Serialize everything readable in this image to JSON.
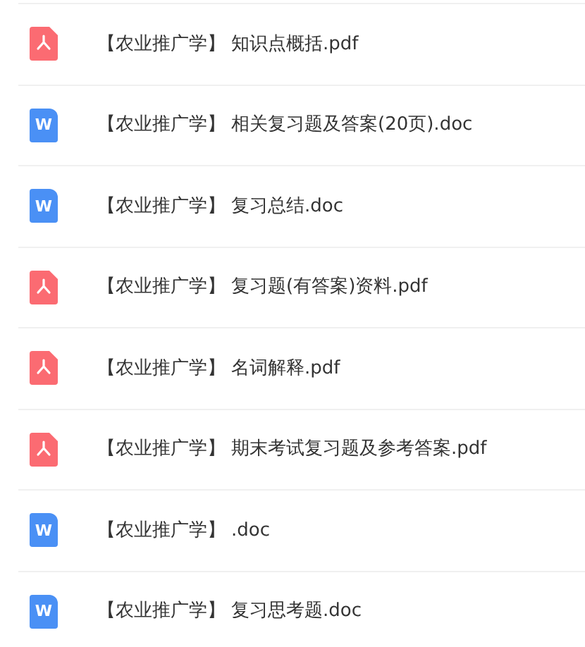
{
  "files": [
    {
      "kind": "pdf",
      "tag": "【农业推广学】",
      "name": "知识点概括.pdf"
    },
    {
      "kind": "doc",
      "badge": "W",
      "tag": "【农业推广学】",
      "name": "相关复习题及答案(20页).doc"
    },
    {
      "kind": "doc",
      "badge": "W",
      "tag": "【农业推广学】",
      "name": "复习总结.doc"
    },
    {
      "kind": "pdf",
      "tag": "【农业推广学】",
      "name": "复习题(有答案)资料.pdf"
    },
    {
      "kind": "pdf",
      "tag": "【农业推广学】",
      "name": "名词解释.pdf"
    },
    {
      "kind": "pdf",
      "tag": "【农业推广学】",
      "name": "期末考试复习题及参考答案.pdf"
    },
    {
      "kind": "doc",
      "badge": "W",
      "tag": "【农业推广学】",
      "name": ".doc"
    },
    {
      "kind": "doc",
      "badge": "W",
      "tag": "【农业推广学】",
      "name": "复习思考题.doc"
    }
  ]
}
